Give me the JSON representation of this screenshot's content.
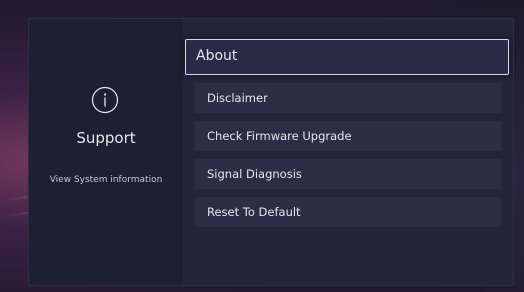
{
  "sidebar": {
    "icon": "info-icon",
    "title": "Support",
    "subtitle": "View System information"
  },
  "menu": {
    "items": [
      {
        "label": "About",
        "selected": true
      },
      {
        "label": "Disclaimer",
        "selected": false
      },
      {
        "label": "Check Firmware Upgrade",
        "selected": false
      },
      {
        "label": "Signal Diagnosis",
        "selected": false
      },
      {
        "label": "Reset To Default",
        "selected": false
      }
    ]
  },
  "colors": {
    "panel": "#24243a",
    "left_pane": "#1f1f33",
    "item": "#2d2d45",
    "highlight_border": "#d8d8e6"
  }
}
